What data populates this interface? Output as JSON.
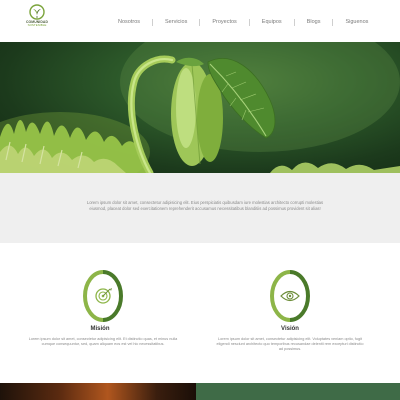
{
  "brand": {
    "name": "COMUNIDAD",
    "tagline": "SOSTENIBLE",
    "accent_color": "#7aa33a"
  },
  "nav": {
    "items": [
      {
        "label": "Nosotros"
      },
      {
        "label": "Servicios"
      },
      {
        "label": "Proyectos"
      },
      {
        "label": "Equipos"
      },
      {
        "label": "Blogs"
      },
      {
        "label": "Siguenos"
      }
    ]
  },
  "hero": {
    "image": "seedling-sprout-image"
  },
  "intro": {
    "text": "Lorem ipsum dolor sit amet, consectetur adipisicing elit. Eius perspiciatis quibusdam iure molestias architecto corrupti molestias eiusmod, placeat dolor sed exercitationem reprehenderit accusamus necessitatibus blanditiis ad possimus provident sit alias!"
  },
  "mission": {
    "title": "Misión",
    "icon": "target-icon",
    "text": "Lorem ipsum dolor sit amet, consectetur adipisicing elit. Et distinctio quas, et minus nulla cumque consequuntur, sed, quam aliquam eos est vel hic necessitatibus."
  },
  "vision": {
    "title": "Visión",
    "icon": "eye-icon",
    "text": "Lorem ipsum dolor sit amet, consectetur adipisicing elit. Voluptates veniam optio, fugit eligendi nesciunt architecto quo temporibus recusandae deleniti rem excepturi distinctio ad possimus."
  },
  "colors": {
    "ring_primary": "#8db548",
    "ring_secondary": "#4a7a2a",
    "band_background": "#efefef",
    "bottom_green": "#3f6b47"
  }
}
